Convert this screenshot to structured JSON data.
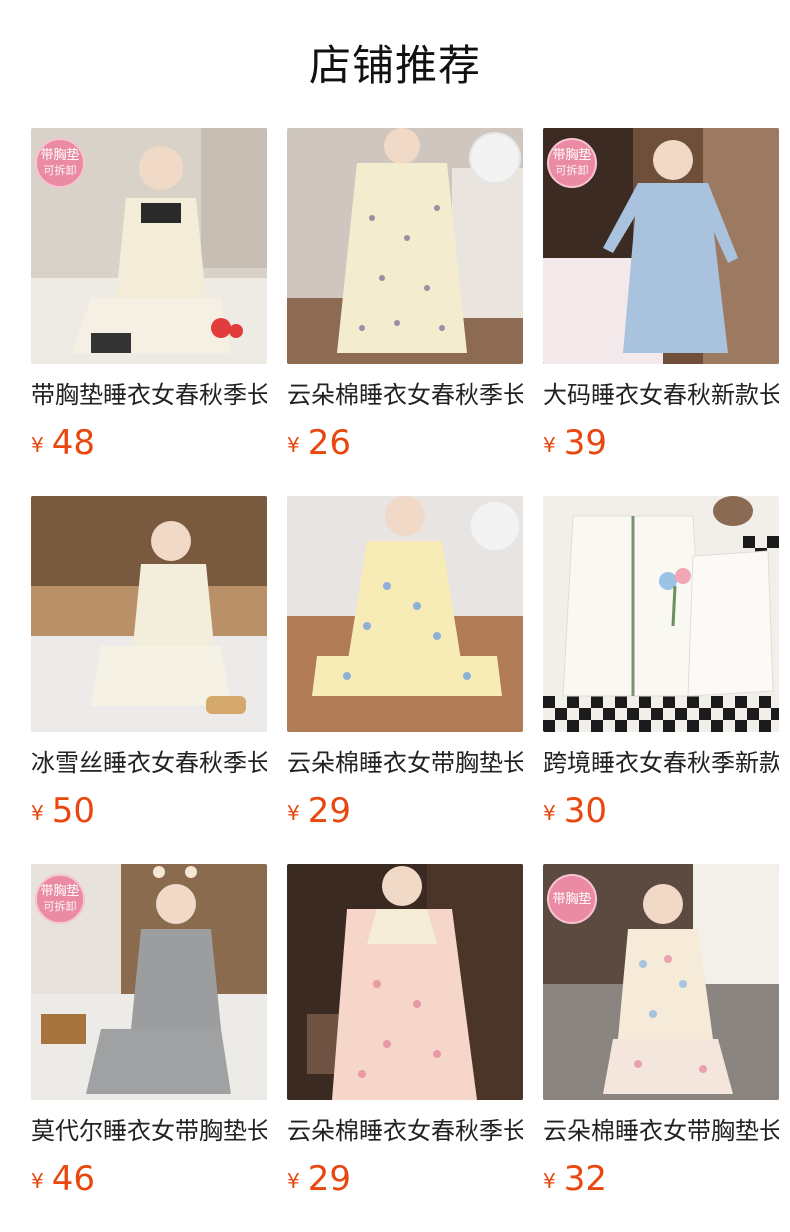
{
  "page": {
    "title": "店铺推荐"
  },
  "products": [
    {
      "name": "带胸垫睡衣女春秋季长袖",
      "currency": "¥",
      "price": "48",
      "badge": [
        "带胸垫",
        "可拆卸"
      ],
      "pad_icon": false
    },
    {
      "name": "云朵棉睡衣女春秋季长袖",
      "currency": "¥",
      "price": "26",
      "badge": null,
      "pad_icon": true
    },
    {
      "name": "大码睡衣女春秋新款长袖",
      "currency": "¥",
      "price": "39",
      "badge": [
        "带胸垫",
        "可拆卸"
      ],
      "pad_icon": false
    },
    {
      "name": "冰雪丝睡衣女春秋季长袖",
      "currency": "¥",
      "price": "50",
      "badge": null,
      "pad_icon": false
    },
    {
      "name": "云朵棉睡衣女带胸垫长袖",
      "currency": "¥",
      "price": "29",
      "badge": null,
      "pad_icon": true
    },
    {
      "name": "跨境睡衣女春秋季新款长袖",
      "currency": "¥",
      "price": "30",
      "badge": null,
      "pad_icon": false
    },
    {
      "name": "莫代尔睡衣女带胸垫长袖",
      "currency": "¥",
      "price": "46",
      "badge": [
        "带胸垫",
        "可拆卸"
      ],
      "pad_icon": false
    },
    {
      "name": "云朵棉睡衣女春秋季长袖",
      "currency": "¥",
      "price": "29",
      "badge": null,
      "pad_icon": false
    },
    {
      "name": "云朵棉睡衣女带胸垫长袖",
      "currency": "¥",
      "price": "32",
      "badge": [
        "带胸垫"
      ],
      "pad_icon": false
    }
  ]
}
